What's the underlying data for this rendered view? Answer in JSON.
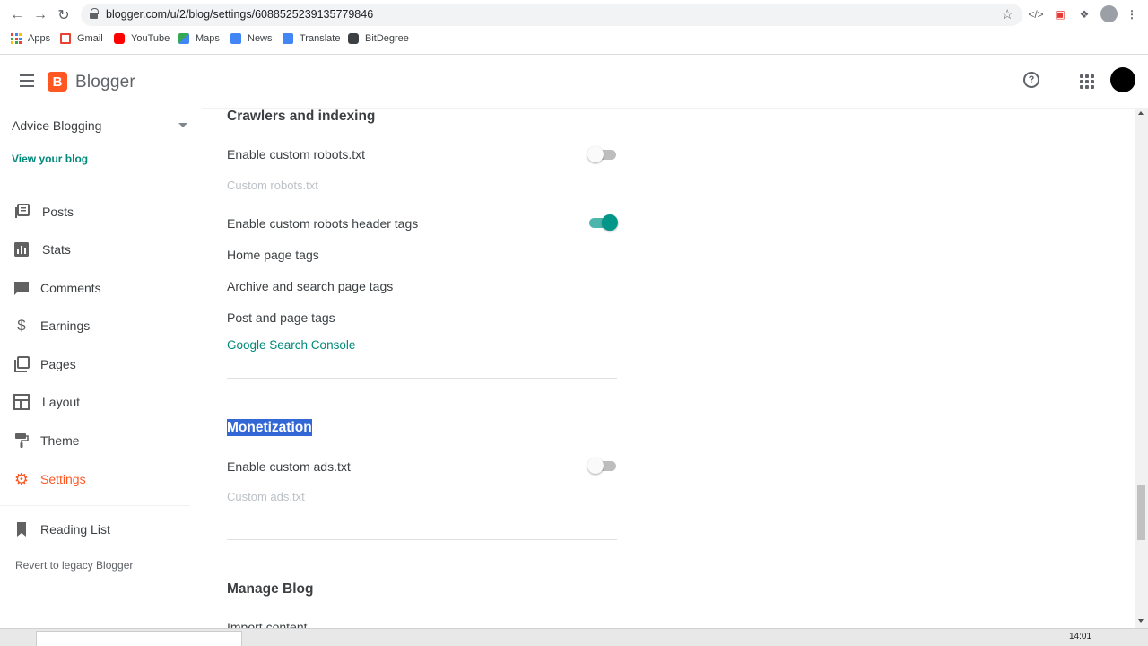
{
  "browser": {
    "url": "blogger.com/u/2/blog/settings/6088525239135779846",
    "bookmarks": [
      {
        "label": "Apps",
        "icon": "apps-grid-icon"
      },
      {
        "label": "Gmail",
        "icon": "gmail-icon"
      },
      {
        "label": "YouTube",
        "icon": "youtube-icon"
      },
      {
        "label": "Maps",
        "icon": "maps-icon"
      },
      {
        "label": "News",
        "icon": "news-icon"
      },
      {
        "label": "Translate",
        "icon": "translate-icon"
      },
      {
        "label": "BitDegree",
        "icon": "bitdegree-icon"
      }
    ]
  },
  "header": {
    "brand": "Blogger",
    "logo_letter": "B",
    "help_glyph": "?"
  },
  "sidebar": {
    "blog_name": "Advice Blogging",
    "view_blog": "View your blog",
    "items": [
      {
        "label": "Posts",
        "icon": "posts-icon",
        "active": false
      },
      {
        "label": "Stats",
        "icon": "stats-icon",
        "active": false
      },
      {
        "label": "Comments",
        "icon": "comments-icon",
        "active": false
      },
      {
        "label": "Earnings",
        "icon": "earnings-icon",
        "active": false
      },
      {
        "label": "Pages",
        "icon": "pages-icon",
        "active": false
      },
      {
        "label": "Layout",
        "icon": "layout-icon",
        "active": false
      },
      {
        "label": "Theme",
        "icon": "theme-icon",
        "active": false
      },
      {
        "label": "Settings",
        "icon": "settings-icon",
        "active": true
      }
    ],
    "reading_list": "Reading List",
    "revert": "Revert to legacy Blogger"
  },
  "main": {
    "crawlers": {
      "title": "Crawlers and indexing",
      "custom_robots_label": "Enable custom robots.txt",
      "custom_robots_enabled": false,
      "custom_robots_sub": "Custom robots.txt",
      "header_tags_label": "Enable custom robots header tags",
      "header_tags_enabled": true,
      "home_tags": "Home page tags",
      "archive_tags": "Archive and search page tags",
      "post_tags": "Post and page tags",
      "search_console": "Google Search Console"
    },
    "monetization": {
      "title": "Monetization",
      "ads_label": "Enable custom ads.txt",
      "ads_enabled": false,
      "ads_sub": "Custom ads.txt"
    },
    "manage": {
      "title": "Manage Blog",
      "import": "Import content"
    }
  },
  "taskbar": {
    "clock": "14:01"
  },
  "colors": {
    "accent": "#ff5722",
    "teal": "#00897b",
    "selection": "#3367d6"
  }
}
